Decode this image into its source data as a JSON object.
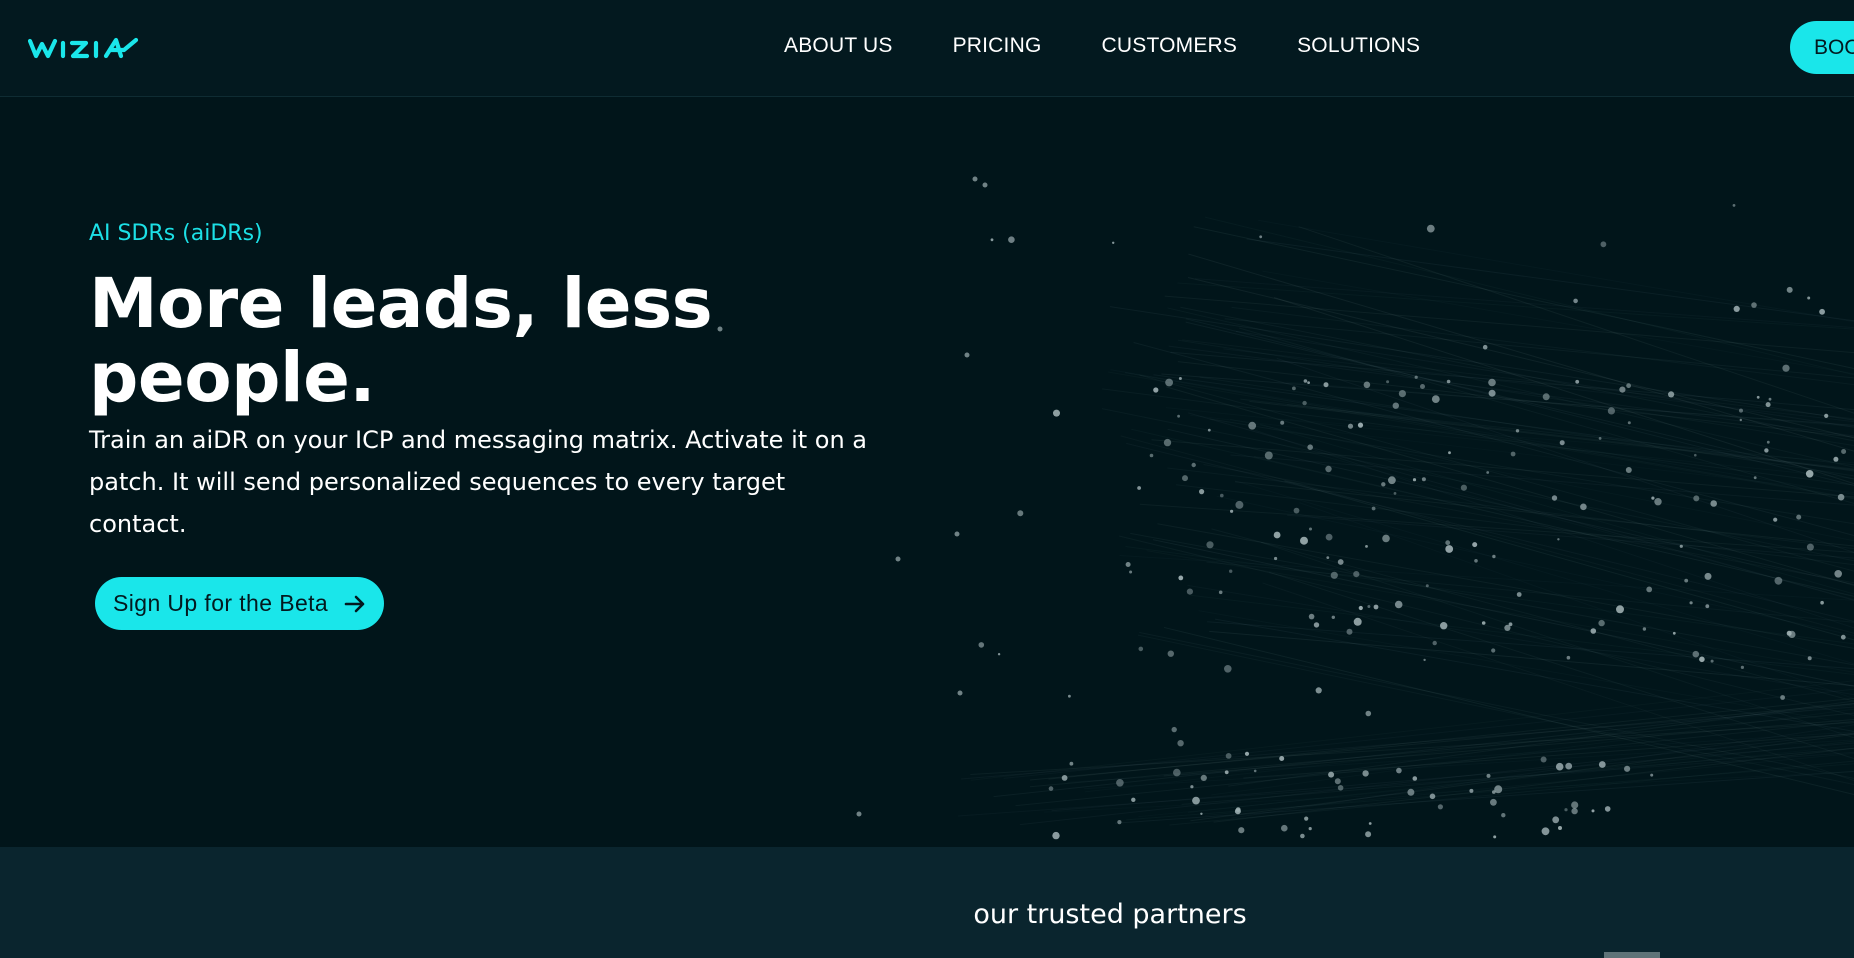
{
  "header": {
    "logo_text": "wizia",
    "nav": [
      {
        "label": "ABOUT US"
      },
      {
        "label": "PRICING"
      },
      {
        "label": "CUSTOMERS"
      },
      {
        "label": "SOLUTIONS"
      }
    ],
    "book_button_label": "BOOK A DEMO"
  },
  "hero": {
    "eyebrow": "AI SDRs (aiDRs)",
    "headline": "More leads, less people.",
    "description": "Train an aiDR on your ICP and messaging matrix. Activate it on a patch. It will send personalized sequences to every target contact.",
    "cta_label": "Sign Up for the Beta",
    "cta_icon": "arrow-right-icon"
  },
  "partners": {
    "title": "our trusted partners"
  },
  "colors": {
    "accent": "#1ae6ea",
    "header_bg": "#03191f",
    "hero_bg": "#01151a",
    "partners_bg": "#0a252e",
    "eyebrow": "#1ce0e6"
  }
}
